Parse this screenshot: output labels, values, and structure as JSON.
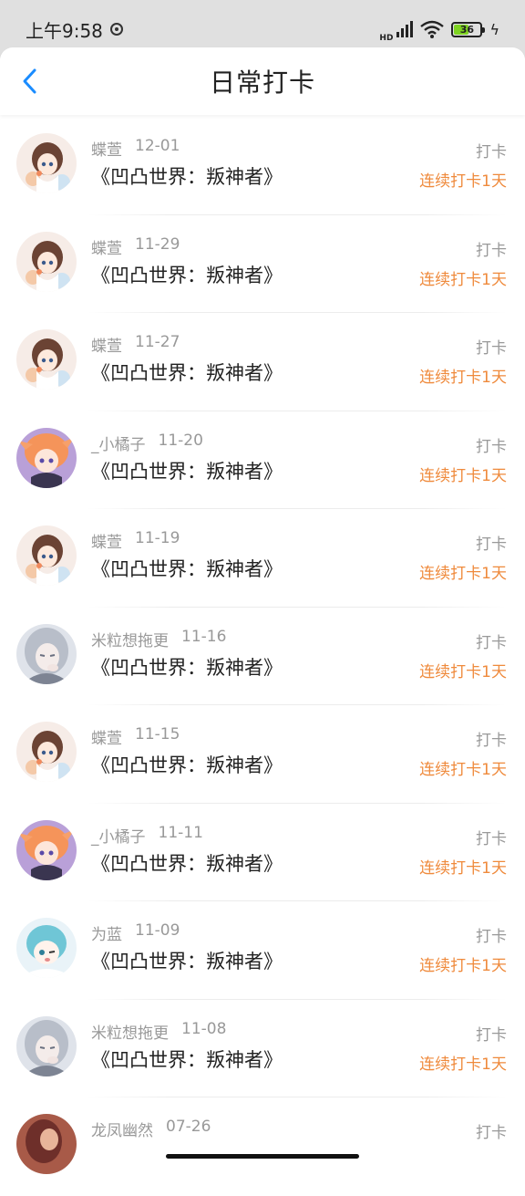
{
  "status_bar": {
    "time": "上午9:58",
    "hd": "HD",
    "battery": "36"
  },
  "nav": {
    "title": "日常打卡"
  },
  "colors": {
    "accent": "#1a8cff",
    "streak": "#ef8a3c",
    "muted": "#999999"
  },
  "items": [
    {
      "user": "蝶萱",
      "date": "12-01",
      "book": "《凹凸世界：叛神者》",
      "tag": "打卡",
      "streak": "连续打卡1天",
      "avatar": "avatar-brown-hair-girl"
    },
    {
      "user": "蝶萱",
      "date": "11-29",
      "book": "《凹凸世界：叛神者》",
      "tag": "打卡",
      "streak": "连续打卡1天",
      "avatar": "avatar-brown-hair-girl"
    },
    {
      "user": "蝶萱",
      "date": "11-27",
      "book": "《凹凸世界：叛神者》",
      "tag": "打卡",
      "streak": "连续打卡1天",
      "avatar": "avatar-brown-hair-girl"
    },
    {
      "user": "_小橘子",
      "date": "11-20",
      "book": "《凹凸世界：叛神者》",
      "tag": "打卡",
      "streak": "连续打卡1天",
      "avatar": "avatar-orange-hair"
    },
    {
      "user": "蝶萱",
      "date": "11-19",
      "book": "《凹凸世界：叛神者》",
      "tag": "打卡",
      "streak": "连续打卡1天",
      "avatar": "avatar-brown-hair-girl"
    },
    {
      "user": "米粒想拖更",
      "date": "11-16",
      "book": "《凹凸世界：叛神者》",
      "tag": "打卡",
      "streak": "连续打卡1天",
      "avatar": "avatar-silver-hair"
    },
    {
      "user": "蝶萱",
      "date": "11-15",
      "book": "《凹凸世界：叛神者》",
      "tag": "打卡",
      "streak": "连续打卡1天",
      "avatar": "avatar-brown-hair-girl"
    },
    {
      "user": "_小橘子",
      "date": "11-11",
      "book": "《凹凸世界：叛神者》",
      "tag": "打卡",
      "streak": "连续打卡1天",
      "avatar": "avatar-orange-hair"
    },
    {
      "user": "为蓝",
      "date": "11-09",
      "book": "《凹凸世界：叛神者》",
      "tag": "打卡",
      "streak": "连续打卡1天",
      "avatar": "avatar-blue-hair"
    },
    {
      "user": "米粒想拖更",
      "date": "11-08",
      "book": "《凹凸世界：叛神者》",
      "tag": "打卡",
      "streak": "连续打卡1天",
      "avatar": "avatar-silver-hair"
    },
    {
      "user": "龙凤幽然",
      "date": "07-26",
      "tag": "打卡",
      "avatar": "avatar-dark-portrait"
    }
  ]
}
